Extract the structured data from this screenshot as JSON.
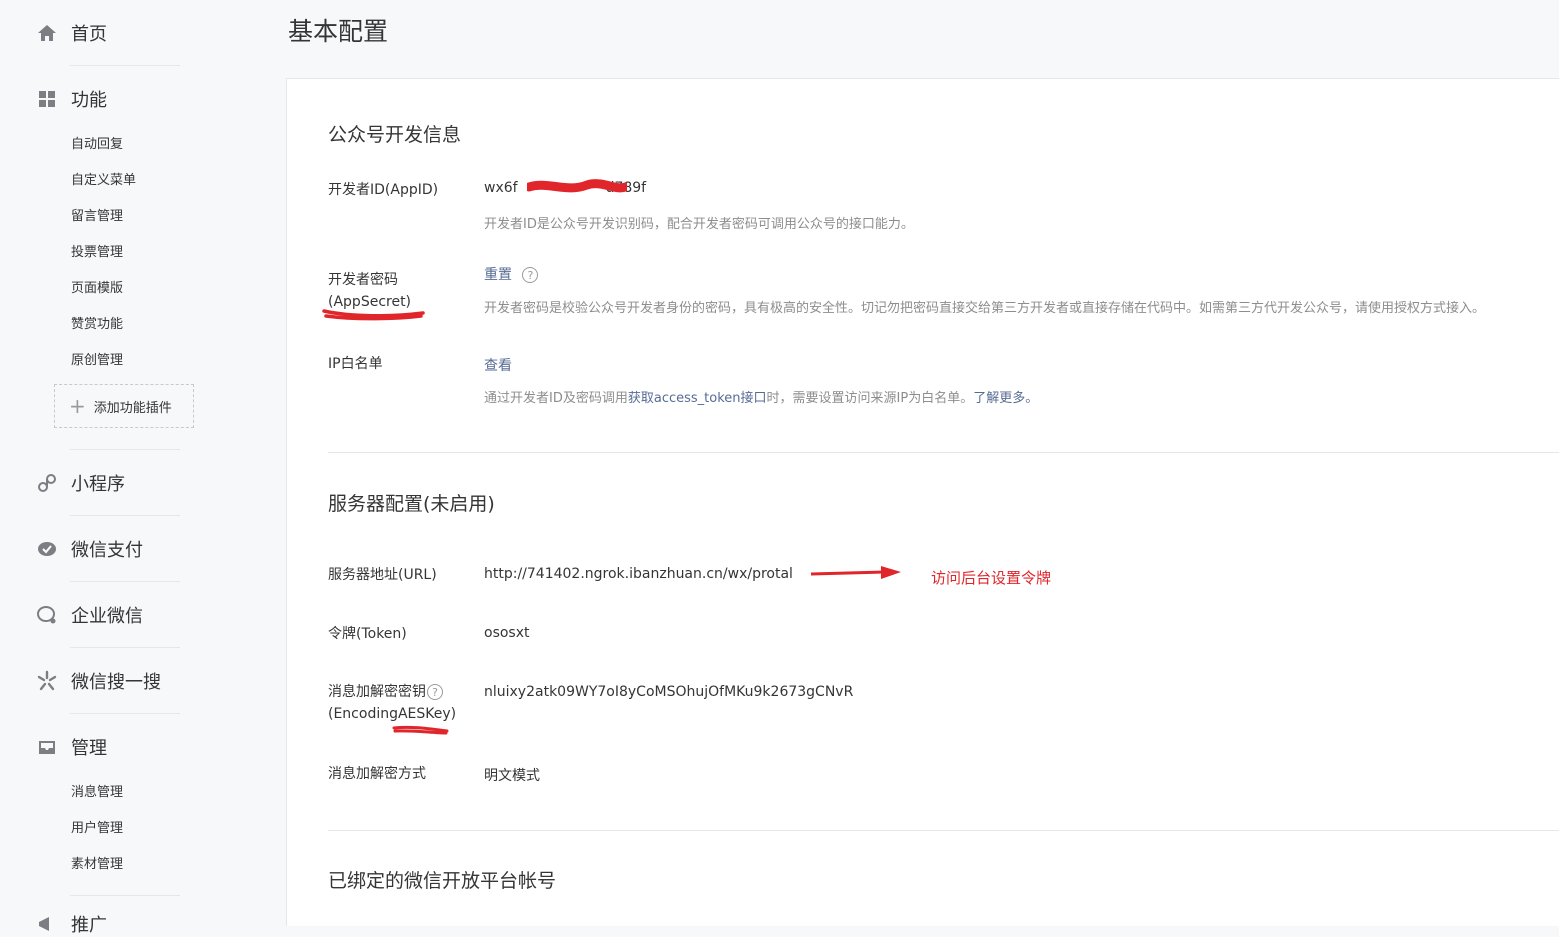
{
  "page_title": "基本配置",
  "sidebar": {
    "home": "首页",
    "features": {
      "label": "功能",
      "items": [
        "自动回复",
        "自定义菜单",
        "留言管理",
        "投票管理",
        "页面模版",
        "赞赏功能",
        "原创管理"
      ],
      "add_plugin": "添加功能插件"
    },
    "mini_program": "小程序",
    "wechat_pay": "微信支付",
    "enterprise_wechat": "企业微信",
    "wechat_search": "微信搜一搜",
    "management": {
      "label": "管理",
      "items": [
        "消息管理",
        "用户管理",
        "素材管理"
      ]
    },
    "promotion": "推广"
  },
  "dev_info": {
    "title": "公众号开发信息",
    "appid": {
      "label": "开发者ID(AppID)",
      "value_start": "wx6f",
      "value_end": "d789f",
      "desc": "开发者ID是公众号开发识别码，配合开发者密码可调用公众号的接口能力。"
    },
    "appsecret": {
      "label_line1": "开发者密码",
      "label_line2": "(AppSecret)",
      "action": "重置",
      "desc": "开发者密码是校验公众号开发者身份的密码，具有极高的安全性。切记勿把密码直接交给第三方开发者或直接存储在代码中。如需第三方代开发公众号，请使用授权方式接入。"
    },
    "ip_whitelist": {
      "label": "IP白名单",
      "action": "查看",
      "desc_a": "通过开发者ID及密码调用",
      "desc_link": "获取access_token接口",
      "desc_b": "时，需要设置访问来源IP为白名单。",
      "desc_more": "了解更多。"
    }
  },
  "server_config": {
    "title": "服务器配置(未启用)",
    "url": {
      "label": "服务器地址(URL)",
      "value": "http://741402.ngrok.ibanzhuan.cn/wx/protal"
    },
    "annotation": "访问后台设置令牌",
    "token": {
      "label": "令牌(Token)",
      "value": "ososxt"
    },
    "aeskey": {
      "label_line1": "消息加解密密钥",
      "label_line2": "(EncodingAESKey)",
      "value": "nluixy2atk09WY7oI8yCoMSOhujOfMKu9k2673gCNvR"
    },
    "encrypt_mode": {
      "label": "消息加解密方式",
      "value": "明文模式"
    }
  },
  "bound_platform": {
    "title": "已绑定的微信开放平台帐号"
  },
  "help_glyph": "?",
  "add_glyph": "+",
  "colors": {
    "annotation": "#e0262b",
    "link": "#576b95",
    "desc": "#8d8d8d"
  }
}
